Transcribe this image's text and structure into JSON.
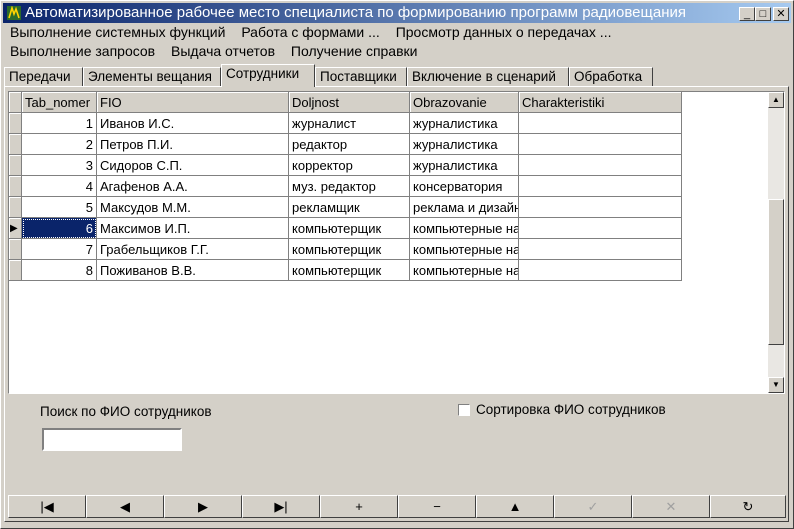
{
  "window": {
    "title": "Автоматизированное рабочее место специалиста по формированию программ радиовещания",
    "btn_min": "_",
    "btn_max": "□",
    "btn_close": "✕"
  },
  "menu": {
    "row1": [
      "Выполнение системных функций",
      "Работа с формами ...",
      "Просмотр данных о передачах ..."
    ],
    "row2": [
      "Выполнение запросов",
      "Выдача отчетов",
      "Получение справки"
    ]
  },
  "tabs": [
    "Передачи",
    "Элементы вещания",
    "Сотрудники",
    "Поставщики",
    "Включение в сценарий",
    "Обработка"
  ],
  "active_tab": "Сотрудники",
  "grid": {
    "columns": [
      "Tab_nomer",
      "FIO",
      "Doljnost",
      "Obrazovanie",
      "Charakteristiki"
    ],
    "rows": [
      [
        "1",
        "Иванов И.С.",
        "журналист",
        "журналистика",
        ""
      ],
      [
        "2",
        "Петров П.И.",
        "редактор",
        "журналистика",
        ""
      ],
      [
        "3",
        "Сидоров С.П.",
        "корректор",
        "журналистика",
        ""
      ],
      [
        "4",
        "Агафенов А.А.",
        "муз. редактор",
        "консерватория",
        ""
      ],
      [
        "5",
        "Максудов М.М.",
        "рекламщик",
        "реклама и дизайн",
        ""
      ],
      [
        "6",
        "Максимов И.П.",
        "компьютерщик",
        "компьютерные науки",
        ""
      ],
      [
        "7",
        "Грабельщиков Г.Г.",
        "компьютерщик",
        "компьютерные науки",
        ""
      ],
      [
        "8",
        "Поживанов В.В.",
        "компьютерщик",
        "компьютерные науки",
        ""
      ]
    ],
    "selected_row": 6,
    "row_indicator": "▶",
    "scroll_up": "▲",
    "scroll_down": "▼"
  },
  "search": {
    "label": "Поиск по ФИО сотрудников",
    "value": ""
  },
  "sort": {
    "label": "Сортировка ФИО сотрудников",
    "checked": false
  },
  "navigator": {
    "buttons": [
      {
        "name": "first",
        "glyph": "|◀",
        "enabled": true
      },
      {
        "name": "prior",
        "glyph": "◀",
        "enabled": true
      },
      {
        "name": "next",
        "glyph": "▶",
        "enabled": true
      },
      {
        "name": "last",
        "glyph": "▶|",
        "enabled": true
      },
      {
        "name": "insert",
        "glyph": "+",
        "enabled": true
      },
      {
        "name": "delete",
        "glyph": "−",
        "enabled": true
      },
      {
        "name": "edit",
        "glyph": "▲",
        "enabled": true
      },
      {
        "name": "post",
        "glyph": "✓",
        "enabled": false
      },
      {
        "name": "cancel",
        "glyph": "✕",
        "enabled": false
      },
      {
        "name": "refresh",
        "glyph": "↻",
        "enabled": true
      }
    ]
  },
  "colors": {
    "title_start": "#0a246a",
    "title_end": "#a6caf0",
    "selection": "#0a246a",
    "face": "#d4d0c8"
  }
}
